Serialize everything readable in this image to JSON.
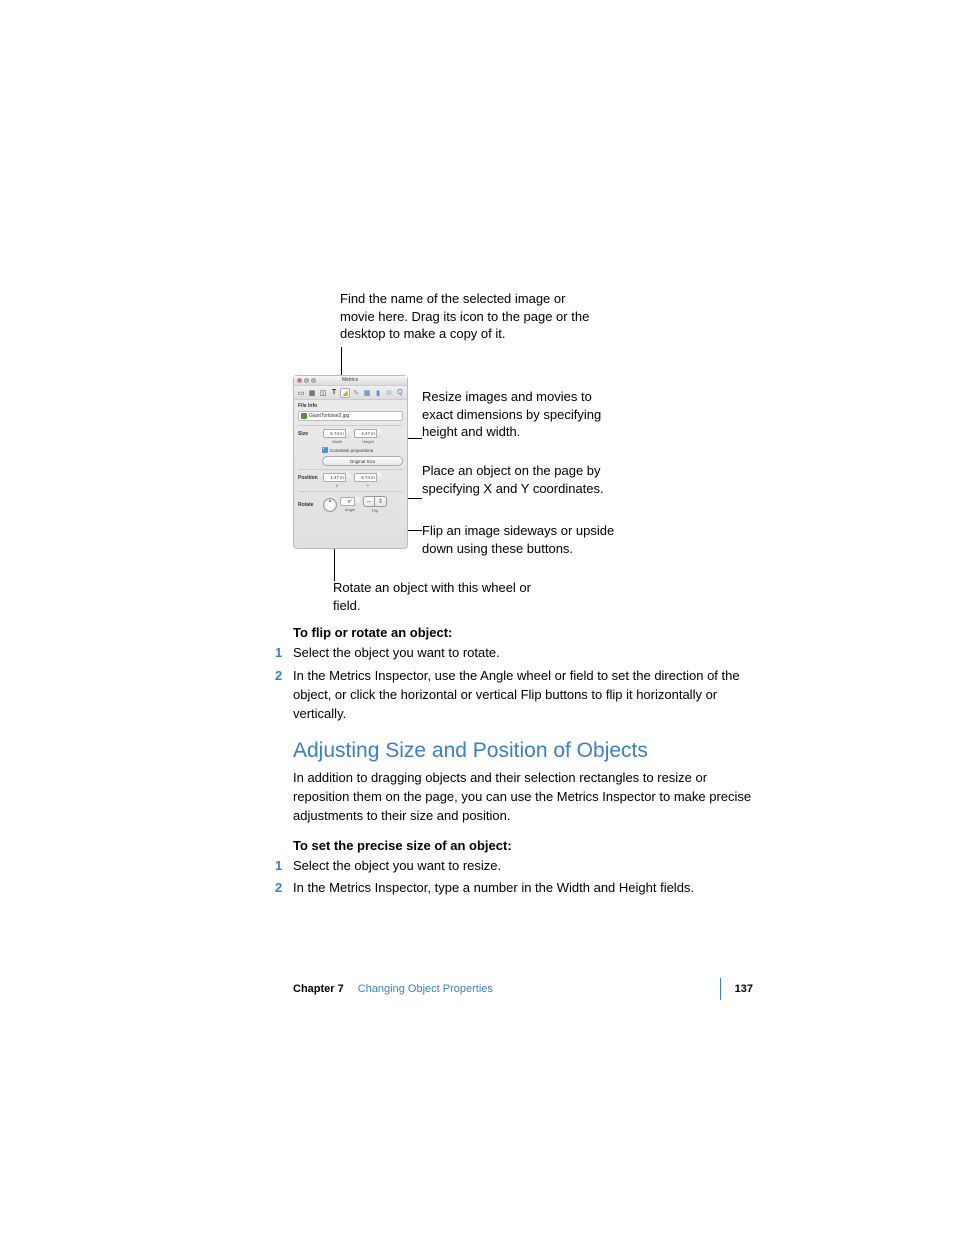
{
  "callouts": {
    "top": "Find the name of the selected image or movie here. Drag its icon to the page or the desktop to make a copy of it.",
    "size": "Resize images and movies to exact dimensions by specifying height and width.",
    "position": "Place an object on the page by specifying X and Y coordinates.",
    "flip": "Flip an image sideways or upside down using these buttons.",
    "rotate": "Rotate an object with this wheel or field."
  },
  "inspector": {
    "window_title": "Metrics",
    "file_info_label": "File Info",
    "file_name": "GiantTortoise2.jpg",
    "size_label": "Size",
    "width_value": "6.74 in",
    "width_sublabel": "Width",
    "height_value": "4.47 in",
    "height_sublabel": "Height",
    "constrain_label": "Constrain proportions",
    "original_size_btn": "Original Size",
    "position_label": "Position",
    "x_value": "1.47 in",
    "x_sublabel": "X",
    "y_value": "5.74 in",
    "y_sublabel": "Y",
    "rotate_label": "Rotate",
    "angle_value": "0°",
    "angle_sublabel": "Angle",
    "flip_sublabel": "Flip"
  },
  "body1": {
    "heading": "To flip or rotate an object:",
    "step1_num": "1",
    "step1": "Select the object you want to rotate.",
    "step2_num": "2",
    "step2": "In the Metrics Inspector, use the Angle wheel or field to set the direction of the object, or click the horizontal or vertical Flip buttons to flip it horizontally or vertically."
  },
  "body2": {
    "section_title": "Adjusting Size and Position of Objects",
    "para": "In addition to dragging objects and their selection rectangles to resize or reposition them on the page, you can use the Metrics Inspector to make precise adjustments to their size and position.",
    "heading": "To set the precise size of an object:",
    "step1_num": "1",
    "step1": "Select the object you want to resize.",
    "step2_num": "2",
    "step2": "In the Metrics Inspector, type a number in the Width and Height fields."
  },
  "footer": {
    "chapter": "Chapter 7",
    "title": "Changing Object Properties",
    "page": "137"
  }
}
